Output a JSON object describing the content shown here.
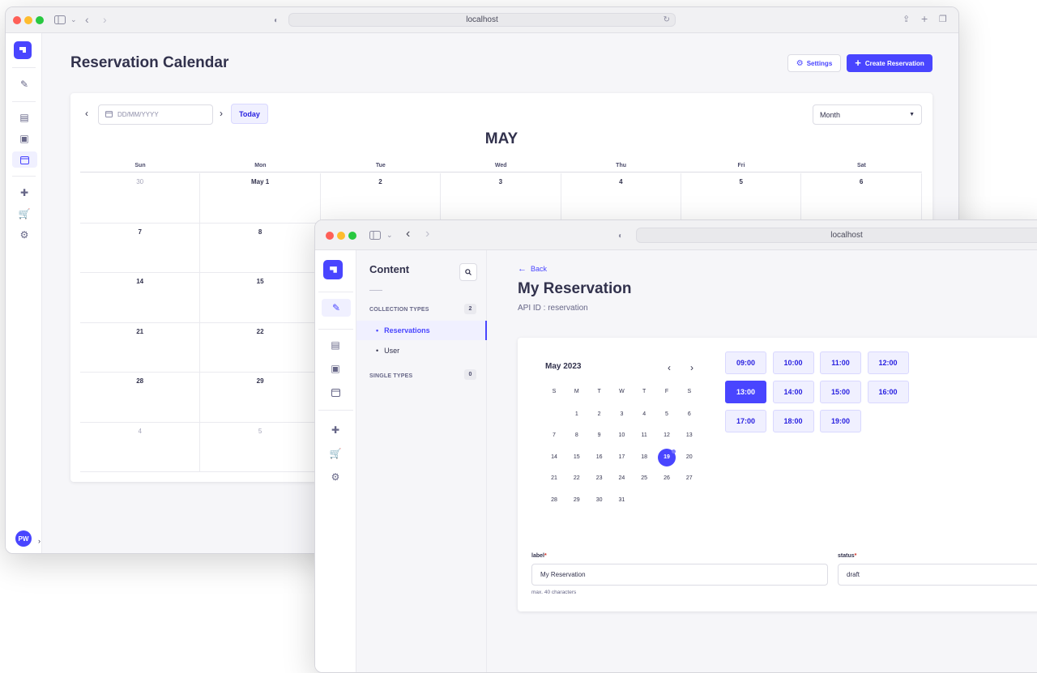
{
  "window1": {
    "url": "localhost",
    "page_title": "Reservation Calendar",
    "settings_label": "Settings",
    "create_label": "Create Reservation",
    "date_placeholder": "DD/MM/YYYY",
    "today_label": "Today",
    "view_select": "Month",
    "month_title": "MAY",
    "weekdays": [
      "Sun",
      "Mon",
      "Tue",
      "Wed",
      "Thu",
      "Fri",
      "Sat"
    ],
    "weeks": [
      [
        "30",
        "May 1",
        "2",
        "3",
        "4",
        "5",
        "6"
      ],
      [
        "7",
        "8",
        "",
        "",
        "",
        "",
        ""
      ],
      [
        "14",
        "15",
        "",
        "",
        "",
        "",
        ""
      ],
      [
        "21",
        "22",
        "",
        "",
        "",
        "",
        ""
      ],
      [
        "28",
        "29",
        "",
        "",
        "",
        "",
        ""
      ],
      [
        "4",
        "5",
        "",
        "",
        "",
        "",
        ""
      ]
    ],
    "avatar_initials": "PW"
  },
  "window2": {
    "url": "localhost",
    "nav_title": "Content",
    "collection_types_label": "COLLECTION TYPES",
    "collection_types_count": "2",
    "collection_items": [
      "Reservations",
      "User"
    ],
    "single_types_label": "SINGLE TYPES",
    "single_types_count": "0",
    "back_label": "Back",
    "page_title": "My Reservation",
    "api_id": "API ID : reservation",
    "picker": {
      "month_label": "May 2023",
      "weekdays": [
        "S",
        "M",
        "T",
        "W",
        "T",
        "F",
        "S"
      ],
      "weeks": [
        [
          "",
          "1",
          "2",
          "3",
          "4",
          "5",
          "6"
        ],
        [
          "7",
          "8",
          "9",
          "10",
          "11",
          "12",
          "13"
        ],
        [
          "14",
          "15",
          "16",
          "17",
          "18",
          "19",
          "20"
        ],
        [
          "21",
          "22",
          "23",
          "24",
          "25",
          "26",
          "27"
        ],
        [
          "28",
          "29",
          "30",
          "31",
          "",
          "",
          ""
        ]
      ],
      "selected_day": "19"
    },
    "time_slots": [
      [
        "09:00",
        "10:00",
        "11:00",
        "12:00"
      ],
      [
        "13:00",
        "14:00",
        "15:00",
        "16:00"
      ],
      [
        "17:00",
        "18:00",
        "19:00"
      ]
    ],
    "selected_slot": "13:00",
    "label_field": {
      "label": "label",
      "required_mark": "*",
      "value": "My Reservation",
      "hint": "max. 40 characters"
    },
    "status_field": {
      "label": "status",
      "required_mark": "*",
      "value": "draft"
    }
  },
  "colors": {
    "accent": "#4945ff",
    "accent_light": "#f0f0ff",
    "danger": "#d02b20"
  }
}
